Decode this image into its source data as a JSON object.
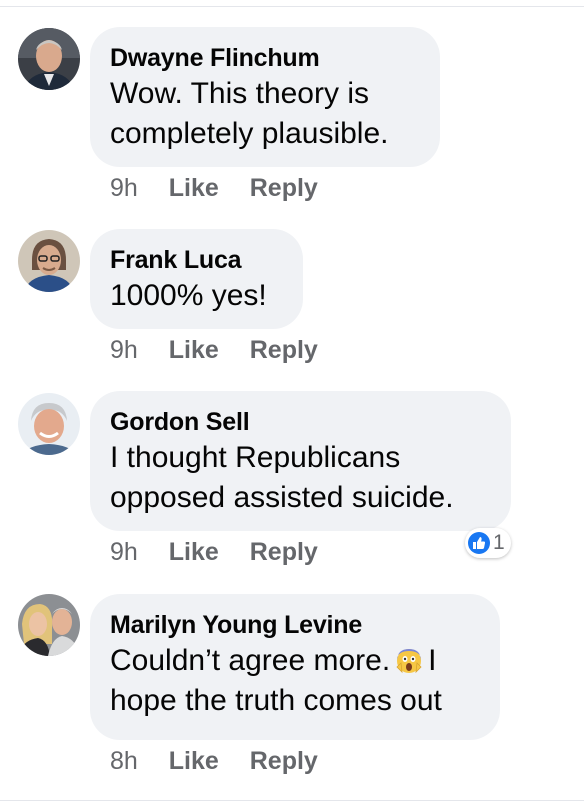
{
  "comments": [
    {
      "author": "Dwayne Flinchum",
      "lines": [
        "Wow. This theory is",
        "completely plausible."
      ],
      "time": "9h",
      "like": "Like",
      "reply": "Reply"
    },
    {
      "author": "Frank Luca",
      "lines": [
        "1000% yes!"
      ],
      "time": "9h",
      "like": "Like",
      "reply": "Reply"
    },
    {
      "author": "Gordon Sell",
      "lines": [
        "I thought Republicans",
        "opposed assisted suicide."
      ],
      "time": "9h",
      "like": "Like",
      "reply": "Reply",
      "reaction_icon": "like-icon",
      "reaction_count": "1"
    },
    {
      "author": "Marilyn Young Levine",
      "line1_before_emoji": "Couldn’t agree more.",
      "line1_emoji": "screaming-face-emoji",
      "line1_after_emoji": "I",
      "line2": "hope the truth comes out",
      "time": "8h",
      "like": "Like",
      "reply": "Reply"
    }
  ],
  "colors": {
    "bubble": "#f0f2f5",
    "meta_text": "#65676b",
    "like_blue": "#1877f2"
  }
}
